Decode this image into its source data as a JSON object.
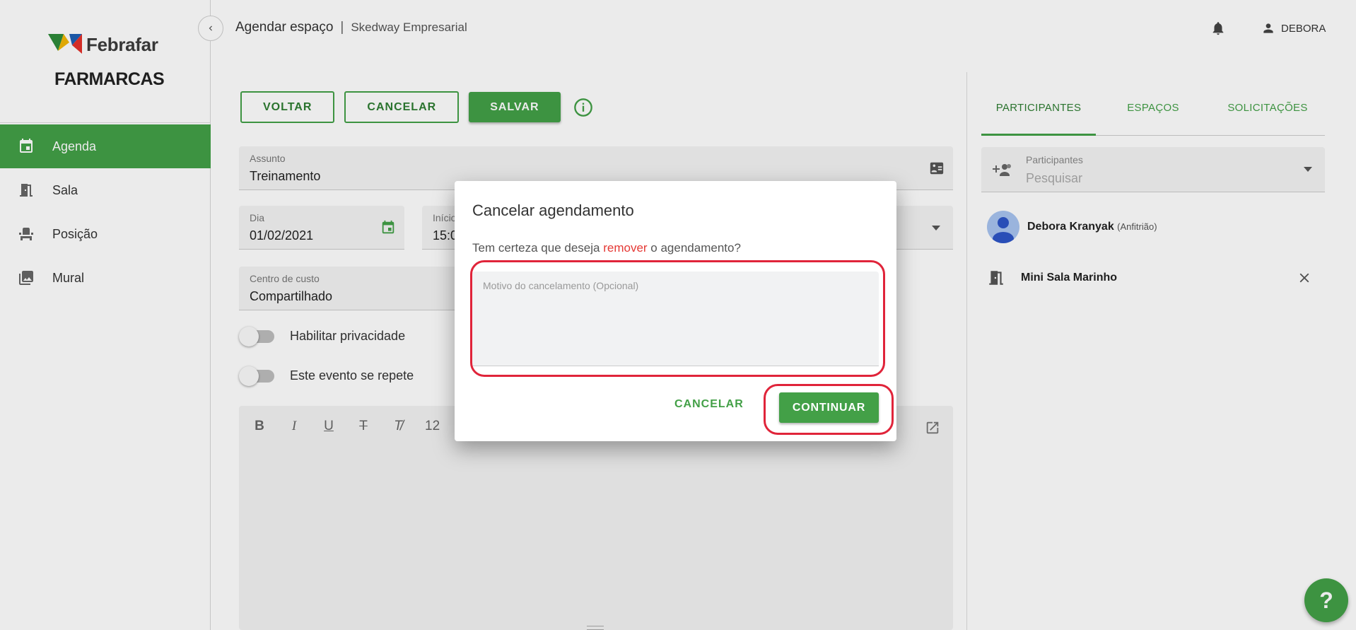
{
  "colors": {
    "accent": "#43a047",
    "danger": "#e53935",
    "highlight": "#e0243a"
  },
  "sidebar": {
    "logo": {
      "top": "Febrafar",
      "bottom": "FARMARCAS"
    },
    "items": [
      {
        "label": "Agenda",
        "icon": "calendar-icon",
        "active": true
      },
      {
        "label": "Sala",
        "icon": "door-icon"
      },
      {
        "label": "Posição",
        "icon": "seat-icon"
      },
      {
        "label": "Mural",
        "icon": "image-icon"
      }
    ]
  },
  "header": {
    "title": "Agendar espaço",
    "separator": "|",
    "subtitle": "Skedway Empresarial",
    "user": "DEBORA"
  },
  "toolbar": {
    "back": "VOLTAR",
    "cancel": "CANCELAR",
    "save": "SALVAR"
  },
  "form": {
    "subject": {
      "label": "Assunto",
      "value": "Treinamento"
    },
    "day": {
      "label": "Dia",
      "value": "01/02/2021"
    },
    "start": {
      "label": "Início",
      "value": "15:0"
    },
    "cost_center": {
      "label": "Centro de custo",
      "value": "Compartilhado"
    },
    "privacy": {
      "label": "Habilitar privacidade",
      "on": false
    },
    "repeat": {
      "label": "Este evento se repete",
      "on": false
    },
    "editor": {
      "font_size": "12"
    }
  },
  "right_panel": {
    "tabs": [
      "PARTICIPANTES",
      "ESPAÇOS",
      "SOLICITAÇÕES"
    ],
    "active_tab": 0,
    "participants": {
      "label": "Participantes",
      "placeholder": "Pesquisar"
    },
    "host": {
      "name": "Debora Kranyak",
      "role": "(Anfitrião)"
    },
    "room": {
      "name": "Mini Sala Marinho"
    }
  },
  "dialog": {
    "title": "Cancelar agendamento",
    "msg_before": "Tem certeza que deseja ",
    "msg_highlight": "remover",
    "msg_after": " o agendamento?",
    "reason_placeholder": "Motivo do cancelamento (Opcional)",
    "cancel": "CANCELAR",
    "continue": "CONTINUAR"
  },
  "help": "?"
}
